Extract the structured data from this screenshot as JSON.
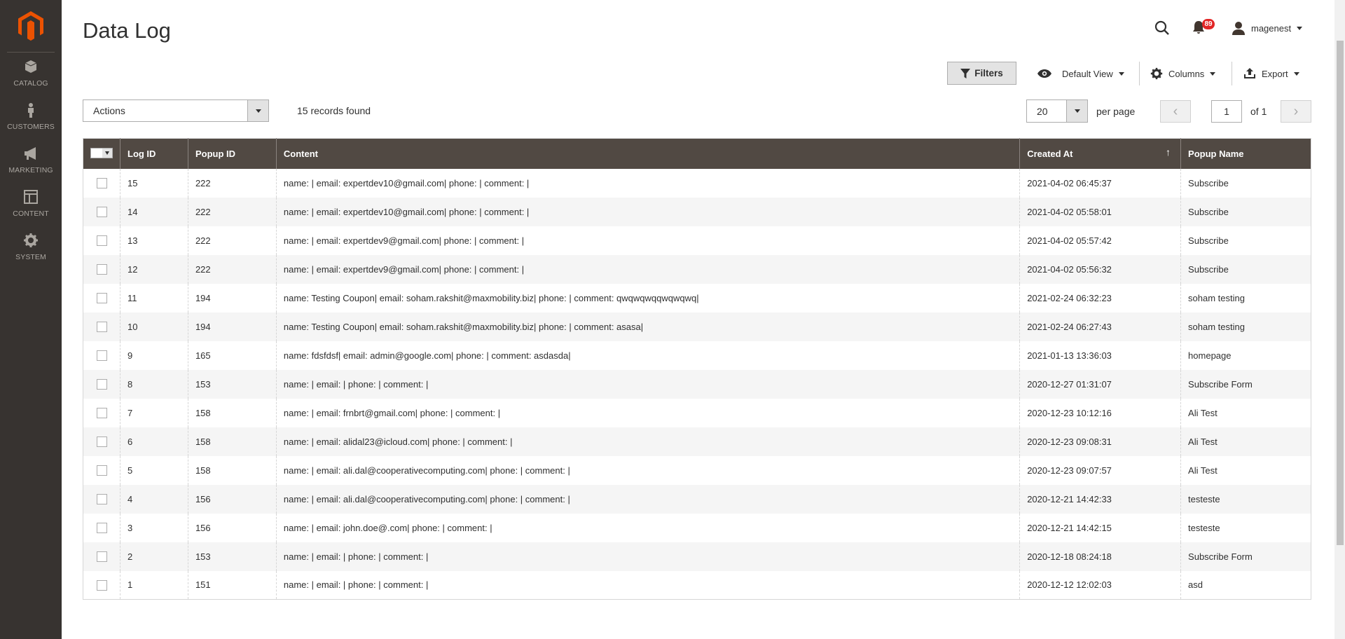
{
  "sidebar": {
    "items": [
      {
        "label": "CATALOG",
        "icon": "box-icon"
      },
      {
        "label": "CUSTOMERS",
        "icon": "person-icon"
      },
      {
        "label": "MARKETING",
        "icon": "megaphone-icon"
      },
      {
        "label": "CONTENT",
        "icon": "layout-icon"
      },
      {
        "label": "SYSTEM",
        "icon": "gear-icon"
      }
    ]
  },
  "header": {
    "title": "Data Log",
    "notifications": "89",
    "user": "magenest"
  },
  "toolbar": {
    "filters": "Filters",
    "view": "Default View",
    "columns": "Columns",
    "export": "Export"
  },
  "grid": {
    "actions": "Actions",
    "records": "15 records found",
    "per_page_value": "20",
    "per_page_label": "per page",
    "page": "1",
    "of_pages": "of 1"
  },
  "colors": {
    "header_bg": "#514943",
    "sidebar_bg": "#373330",
    "logo": "#eb5202",
    "badge": "#e22626"
  },
  "table": {
    "columns": [
      "Log ID",
      "Popup ID",
      "Content",
      "Created At",
      "Popup Name"
    ],
    "rows": [
      [
        "15",
        "222",
        "name: | email: expertdev10@gmail.com| phone: | comment: |",
        "2021-04-02 06:45:37",
        "Subscribe"
      ],
      [
        "14",
        "222",
        "name: | email: expertdev10@gmail.com| phone: | comment: |",
        "2021-04-02 05:58:01",
        "Subscribe"
      ],
      [
        "13",
        "222",
        "name: | email: expertdev9@gmail.com| phone: | comment: |",
        "2021-04-02 05:57:42",
        "Subscribe"
      ],
      [
        "12",
        "222",
        "name: | email: expertdev9@gmail.com| phone: | comment: |",
        "2021-04-02 05:56:32",
        "Subscribe"
      ],
      [
        "11",
        "194",
        "name: Testing Coupon| email: soham.rakshit@maxmobility.biz| phone: | comment: qwqwqwqqwqwqwq|",
        "2021-02-24 06:32:23",
        "soham testing"
      ],
      [
        "10",
        "194",
        "name: Testing Coupon| email: soham.rakshit@maxmobility.biz| phone: | comment: asasa|",
        "2021-02-24 06:27:43",
        "soham testing"
      ],
      [
        "9",
        "165",
        "name: fdsfdsf| email: admin@google.com| phone: | comment: asdasda|",
        "2021-01-13 13:36:03",
        "homepage"
      ],
      [
        "8",
        "153",
        "name: | email: | phone: | comment: |",
        "2020-12-27 01:31:07",
        "Subscribe Form"
      ],
      [
        "7",
        "158",
        "name: | email: frnbrt@gmail.com| phone: | comment: |",
        "2020-12-23 10:12:16",
        "Ali Test"
      ],
      [
        "6",
        "158",
        "name: | email: alidal23@icloud.com| phone: | comment: |",
        "2020-12-23 09:08:31",
        "Ali Test"
      ],
      [
        "5",
        "158",
        "name: | email: ali.dal@cooperativecomputing.com| phone: | comment: |",
        "2020-12-23 09:07:57",
        "Ali Test"
      ],
      [
        "4",
        "156",
        "name: | email: ali.dal@cooperativecomputing.com| phone: | comment: |",
        "2020-12-21 14:42:33",
        "testeste"
      ],
      [
        "3",
        "156",
        "name: | email: john.doe@.com| phone: | comment: |",
        "2020-12-21 14:42:15",
        "testeste"
      ],
      [
        "2",
        "153",
        "name: | email: | phone: | comment: |",
        "2020-12-18 08:24:18",
        "Subscribe Form"
      ],
      [
        "1",
        "151",
        "name: | email: | phone: | comment: |",
        "2020-12-12 12:02:03",
        "asd"
      ]
    ]
  }
}
